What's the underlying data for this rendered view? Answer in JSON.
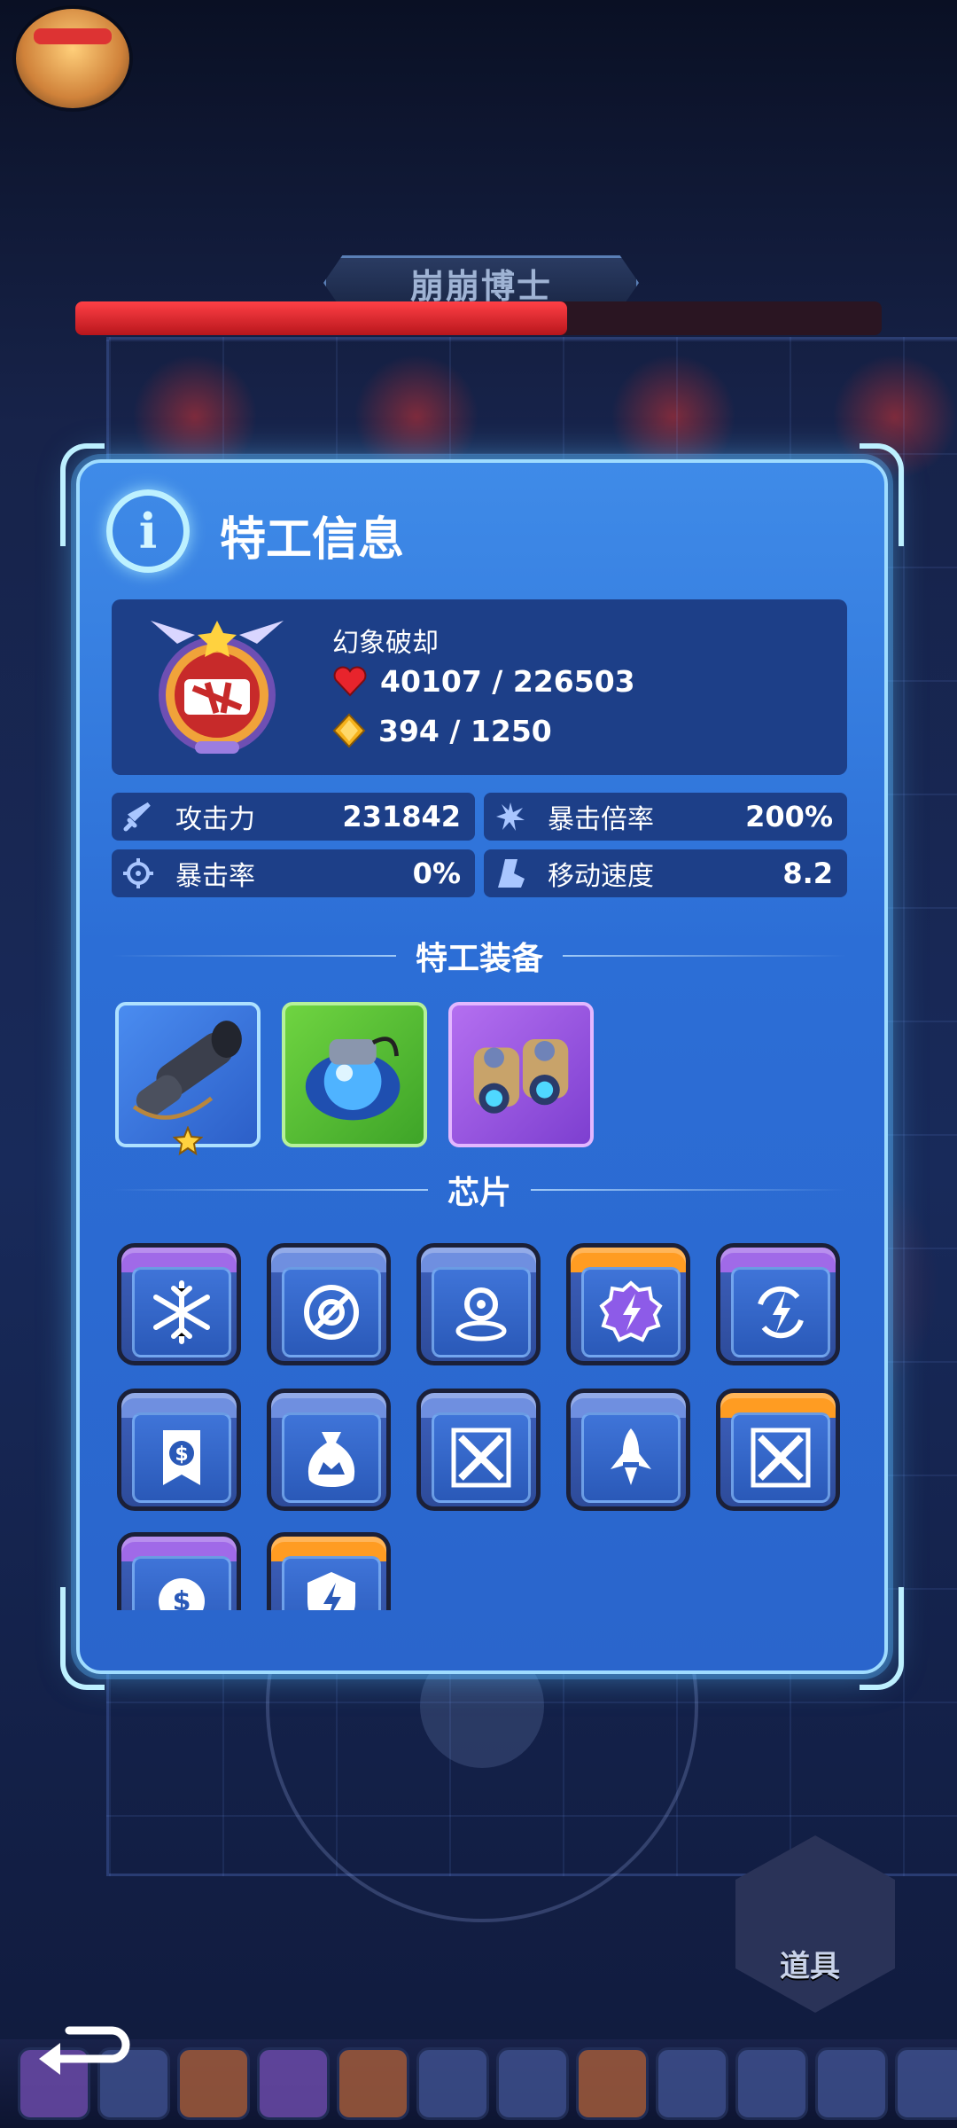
{
  "boss": {
    "name": "崩崩博士",
    "hp_fraction": 0.61
  },
  "dialog": {
    "title": "特工信息",
    "agent": {
      "name": "幻象破却",
      "hp_current": "40107",
      "hp_max": "226503",
      "energy_current": "394",
      "energy_max": "1250"
    },
    "stats": [
      {
        "label": "攻击力",
        "value": "231842",
        "icon": "sword-icon"
      },
      {
        "label": "暴击倍率",
        "value": "200%",
        "icon": "burst-icon"
      },
      {
        "label": "暴击率",
        "value": "0%",
        "icon": "crosshair-icon"
      },
      {
        "label": "移动速度",
        "value": "8.2",
        "icon": "boot-icon"
      }
    ],
    "equipment_label": "特工装备",
    "equipment": [
      {
        "icon": "cannon-icon",
        "rarity": "blue",
        "stars": 1
      },
      {
        "icon": "orb-device-icon",
        "rarity": "green"
      },
      {
        "icon": "jet-boots-icon",
        "rarity": "purple"
      }
    ],
    "chips_label": "芯片",
    "chips": [
      {
        "icon": "snowflake-icon",
        "rarity": "purple"
      },
      {
        "icon": "no-gear-icon",
        "rarity": "blue"
      },
      {
        "icon": "target-beacon-icon",
        "rarity": "blue"
      },
      {
        "icon": "lightning-gear-icon",
        "rarity": "orange"
      },
      {
        "icon": "lightning-cycle-icon",
        "rarity": "purple"
      },
      {
        "icon": "dollar-ribbon-icon",
        "rarity": "blue"
      },
      {
        "icon": "money-bag-icon",
        "rarity": "blue"
      },
      {
        "icon": "cross-blades-icon",
        "rarity": "blue"
      },
      {
        "icon": "rocket-icon",
        "rarity": "blue"
      },
      {
        "icon": "cross-blades-icon",
        "rarity": "orange"
      },
      {
        "icon": "dollar-burst-icon",
        "rarity": "purple"
      },
      {
        "icon": "lightning-shield-icon",
        "rarity": "orange"
      }
    ]
  },
  "hud": {
    "item_button_label": "道具"
  }
}
